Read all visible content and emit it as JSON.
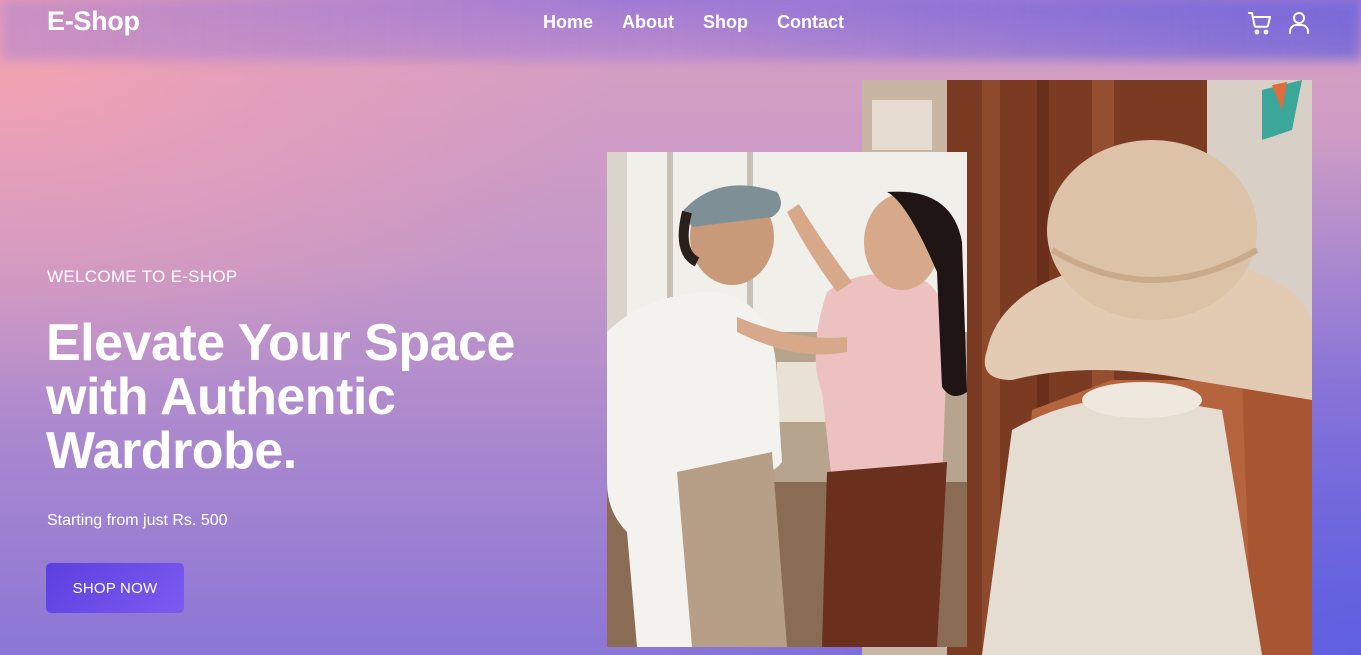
{
  "header": {
    "logo": "E-Shop",
    "nav": [
      "Home",
      "About",
      "Shop",
      "Contact"
    ],
    "icons": [
      "cart-icon",
      "user-icon"
    ]
  },
  "hero": {
    "eyebrow": "WELCOME TO E-SHOP",
    "headline": "Elevate Your Space with Authentic Wardrobe.",
    "subtext": "Starting from just Rs. 500",
    "cta": "SHOP NOW"
  },
  "colors": {
    "accent": "#6a4de8",
    "text": "#ffffff"
  }
}
